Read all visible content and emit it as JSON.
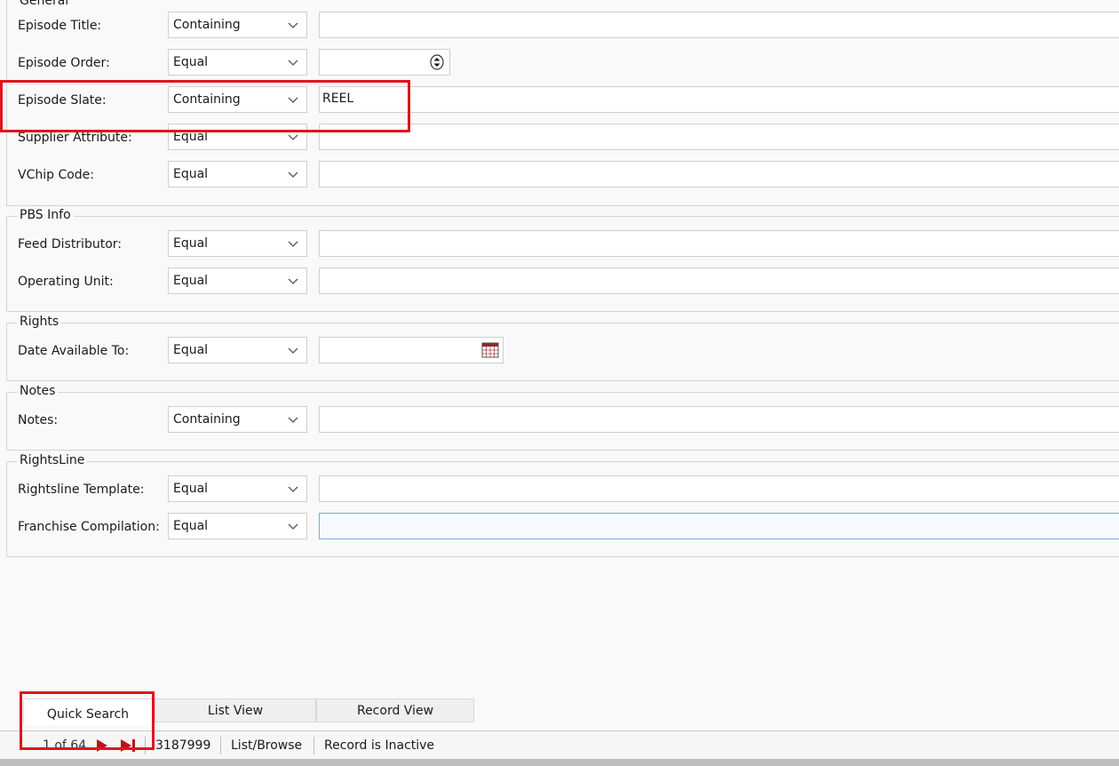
{
  "sections": {
    "general": "General",
    "pbs": "PBS Info",
    "rights": "Rights",
    "notes": "Notes",
    "rightsline": "RightsLine"
  },
  "rows": {
    "episode_title": {
      "label": "Episode Title:",
      "op": "Containing",
      "value": ""
    },
    "episode_order": {
      "label": "Episode Order:",
      "op": "Equal",
      "value": ""
    },
    "episode_slate": {
      "label": "Episode Slate:",
      "op": "Containing",
      "value": "REEL"
    },
    "supplier_attribute": {
      "label": "Supplier Attribute:",
      "op": "Equal",
      "value": ""
    },
    "vchip_code": {
      "label": "VChip Code:",
      "op": "Equal",
      "value": ""
    },
    "feed_distributor": {
      "label": "Feed Distributor:",
      "op": "Equal",
      "value": ""
    },
    "operating_unit": {
      "label": "Operating Unit:",
      "op": "Equal",
      "value": ""
    },
    "date_available_to": {
      "label": "Date Available To:",
      "op": "Equal",
      "value": ""
    },
    "notes": {
      "label": "Notes:",
      "op": "Containing",
      "value": ""
    },
    "rightsline_template": {
      "label": "Rightsline Template:",
      "op": "Equal",
      "value": ""
    },
    "franchise_compilation": {
      "label": "Franchise Compilation:",
      "op": "Equal",
      "value": ""
    }
  },
  "tabs": {
    "quick_search": "Quick Search",
    "list_view": "List View",
    "record_view": "Record View"
  },
  "status": {
    "position": "1 of 64",
    "record_id": "3187999",
    "mode": "List/Browse",
    "record_state": "Record is Inactive"
  },
  "icons": {
    "dropdown": "chevron-down-icon",
    "spinner": "spinner-icon",
    "calendar": "calendar-icon",
    "next": "next-record-icon",
    "last": "last-record-icon"
  },
  "colors": {
    "highlight": "#e0141e",
    "focus_border": "#7fa9d8",
    "nav_arrow": "#b8141c"
  }
}
